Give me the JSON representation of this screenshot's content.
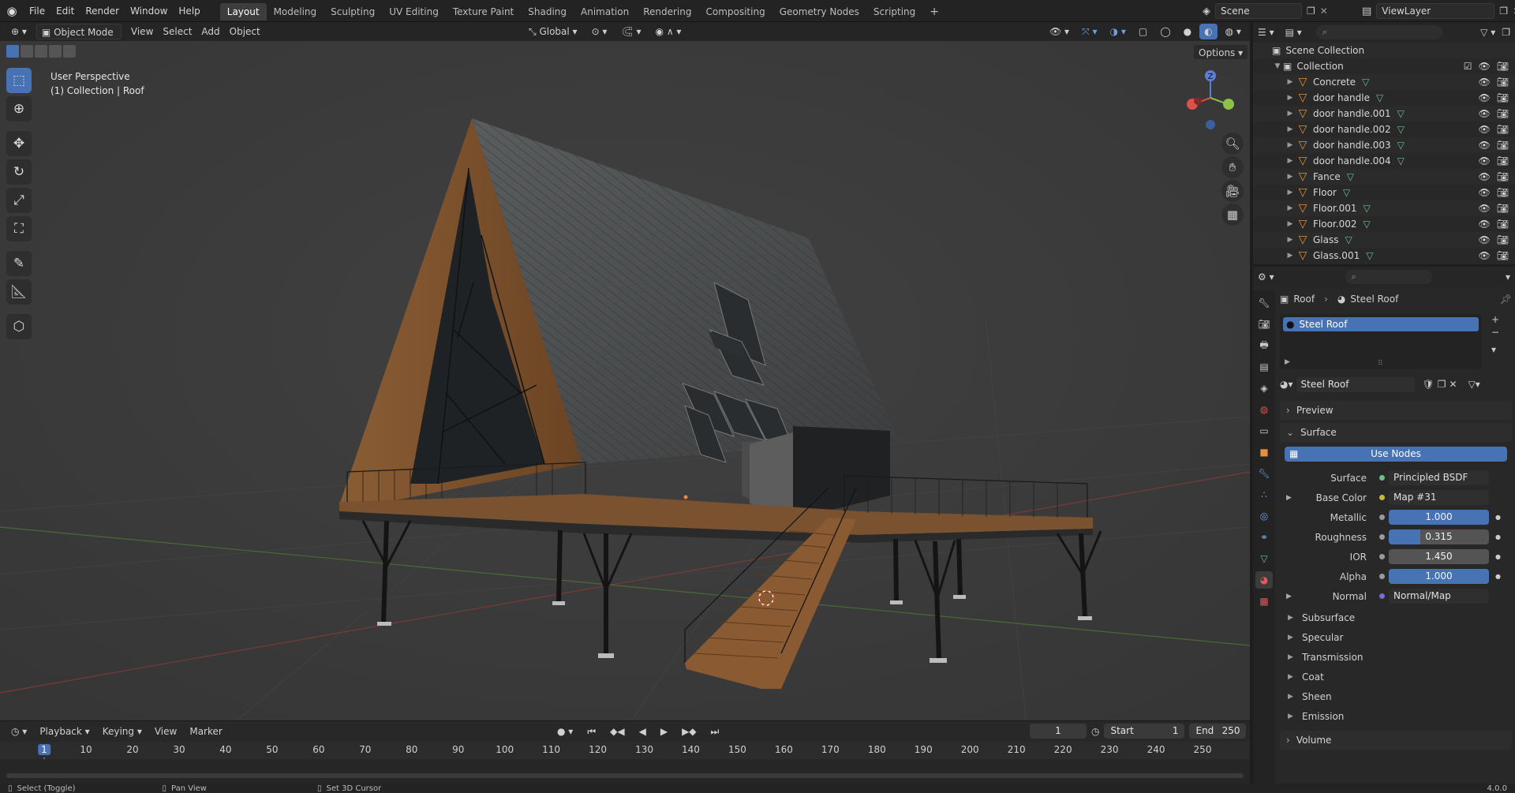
{
  "menu": {
    "items": [
      "File",
      "Edit",
      "Render",
      "Window",
      "Help"
    ]
  },
  "workspaces": [
    "Layout",
    "Modeling",
    "Sculpting",
    "UV Editing",
    "Texture Paint",
    "Shading",
    "Animation",
    "Rendering",
    "Compositing",
    "Geometry Nodes",
    "Scripting"
  ],
  "active_workspace": "Layout",
  "scene": {
    "name": "Scene",
    "view_layer": "ViewLayer"
  },
  "viewport": {
    "mode": "Object Mode",
    "menus": [
      "View",
      "Select",
      "Add",
      "Object"
    ],
    "transform_orientation": "Global",
    "options_label": "Options",
    "overlay_line1": "User Perspective",
    "overlay_line2": "(1) Collection | Roof",
    "gizmo_z": "Z"
  },
  "outliner": {
    "root": "Scene Collection",
    "collection": "Collection",
    "objects": [
      "Concrete",
      "door handle",
      "door handle.001",
      "door handle.002",
      "door handle.003",
      "door handle.004",
      "Fance",
      "Floor",
      "Floor.001",
      "Floor.002",
      "Glass",
      "Glass.001"
    ]
  },
  "properties": {
    "breadcrumb_object": "Roof",
    "breadcrumb_material": "Steel Roof",
    "slot_material": "Steel Roof",
    "material_name": "Steel Roof",
    "panel_preview": "Preview",
    "panel_surface": "Surface",
    "use_nodes": "Use Nodes",
    "surface_label": "Surface",
    "surface_shader": "Principled BSDF",
    "base_color_label": "Base Color",
    "base_color_value": "Map #31",
    "metallic_label": "Metallic",
    "metallic_value": "1.000",
    "metallic_fraction": 1.0,
    "roughness_label": "Roughness",
    "roughness_value": "0.315",
    "roughness_fraction": 0.315,
    "ior_label": "IOR",
    "ior_value": "1.450",
    "alpha_label": "Alpha",
    "alpha_value": "1.000",
    "alpha_fraction": 1.0,
    "normal_label": "Normal",
    "normal_value": "Normal/Map",
    "subpanels": [
      "Subsurface",
      "Specular",
      "Transmission",
      "Coat",
      "Sheen",
      "Emission"
    ],
    "panel_volume": "Volume"
  },
  "timeline": {
    "menus": [
      "Playback",
      "Keying",
      "View",
      "Marker"
    ],
    "current_frame": "1",
    "start_label": "Start",
    "start_value": "1",
    "end_label": "End",
    "end_value": "250",
    "ticks": [
      "1",
      "10",
      "20",
      "30",
      "40",
      "50",
      "60",
      "70",
      "80",
      "90",
      "100",
      "110",
      "120",
      "130",
      "140",
      "150",
      "160",
      "170",
      "180",
      "190",
      "200",
      "210",
      "220",
      "230",
      "240",
      "250"
    ]
  },
  "statusbar": {
    "hint1": "Select (Toggle)",
    "hint2": "Pan View",
    "hint3": "Set 3D Cursor",
    "version": "4.0.0"
  },
  "colors": {
    "accent": "#4772b3",
    "object_icon": "#e3913c",
    "mesh_icon": "#6bbf8e"
  }
}
